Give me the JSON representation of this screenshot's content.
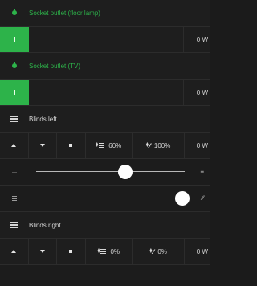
{
  "devices": [
    {
      "name": "Socket outlet (floor lamp)",
      "power": "0 W"
    },
    {
      "name": "Socket outlet (TV)",
      "power": "0 W"
    }
  ],
  "blinds": [
    {
      "name": "Blinds left",
      "position": "60%",
      "slat": "100%",
      "power": "0 W",
      "position_level": 0.6,
      "slat_level": 1.0
    },
    {
      "name": "Blinds right",
      "position": "0%",
      "slat": "0%",
      "power": "0 W"
    }
  ],
  "colors": {
    "accent": "#2db34a",
    "background": "#1c1c1c"
  }
}
